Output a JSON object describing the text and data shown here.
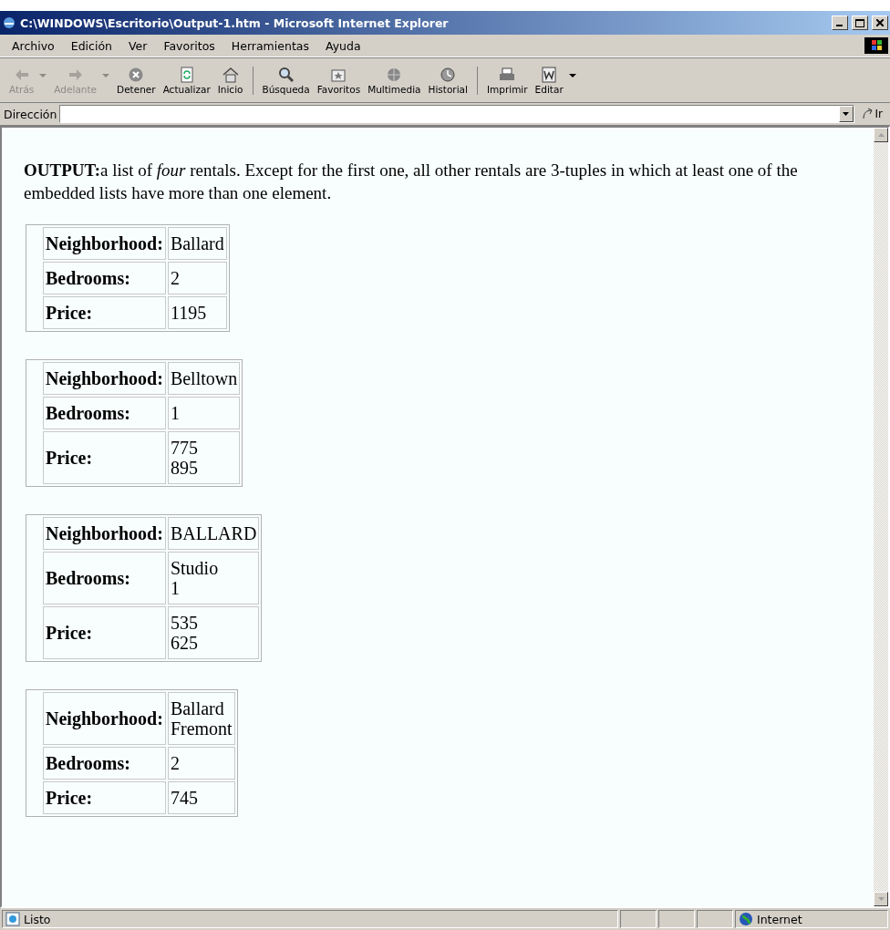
{
  "window": {
    "title": "C:\\WINDOWS\\Escritorio\\Output-1.htm - Microsoft Internet Explorer"
  },
  "menu": [
    "Archivo",
    "Edición",
    "Ver",
    "Favoritos",
    "Herramientas",
    "Ayuda"
  ],
  "toolbar": {
    "groups": [
      [
        {
          "label": "Atrás",
          "disabled": true,
          "dropdown": true
        },
        {
          "label": "Adelante",
          "disabled": true,
          "dropdown": true
        },
        {
          "label": "Detener",
          "disabled": false,
          "dropdown": false
        },
        {
          "label": "Actualizar",
          "disabled": false,
          "dropdown": false
        },
        {
          "label": "Inicio",
          "disabled": false,
          "dropdown": false
        }
      ],
      [
        {
          "label": "Búsqueda",
          "disabled": false,
          "dropdown": false
        },
        {
          "label": "Favoritos",
          "disabled": false,
          "dropdown": false
        },
        {
          "label": "Multimedia",
          "disabled": false,
          "dropdown": false
        },
        {
          "label": "Historial",
          "disabled": false,
          "dropdown": false
        }
      ],
      [
        {
          "label": "Imprimir",
          "disabled": false,
          "dropdown": false
        },
        {
          "label": "Editar",
          "disabled": false,
          "dropdown": true
        }
      ]
    ]
  },
  "address": {
    "label": "Dirección",
    "go": "Ir"
  },
  "page": {
    "intro": "**OUTPUT:**a list of *four* rentals. Except for the first one, all other rentals are 3-tuples in which at least one of the embedded lists have more than one element.",
    "rentals": [
      {
        "rows": [
          {
            "label": "Neighborhood:",
            "values": [
              "Ballard"
            ]
          },
          {
            "label": "Bedrooms:",
            "values": [
              "2"
            ]
          },
          {
            "label": "Price:",
            "values": [
              "1195"
            ]
          }
        ]
      },
      {
        "rows": [
          {
            "label": "Neighborhood:",
            "values": [
              "Belltown"
            ]
          },
          {
            "label": "Bedrooms:",
            "values": [
              "1"
            ]
          },
          {
            "label": "Price:",
            "values": [
              "775",
              "895"
            ]
          }
        ]
      },
      {
        "rows": [
          {
            "label": "Neighborhood:",
            "values": [
              "BALLARD"
            ]
          },
          {
            "label": "Bedrooms:",
            "values": [
              "Studio",
              "1"
            ]
          },
          {
            "label": "Price:",
            "values": [
              "535",
              "625"
            ]
          }
        ]
      },
      {
        "rows": [
          {
            "label": "Neighborhood:",
            "values": [
              "Ballard",
              "Fremont"
            ]
          },
          {
            "label": "Bedrooms:",
            "values": [
              "2"
            ]
          },
          {
            "label": "Price:",
            "values": [
              "745"
            ]
          }
        ]
      }
    ]
  },
  "status_bar": {
    "text": "Listo",
    "zone": "Internet"
  }
}
